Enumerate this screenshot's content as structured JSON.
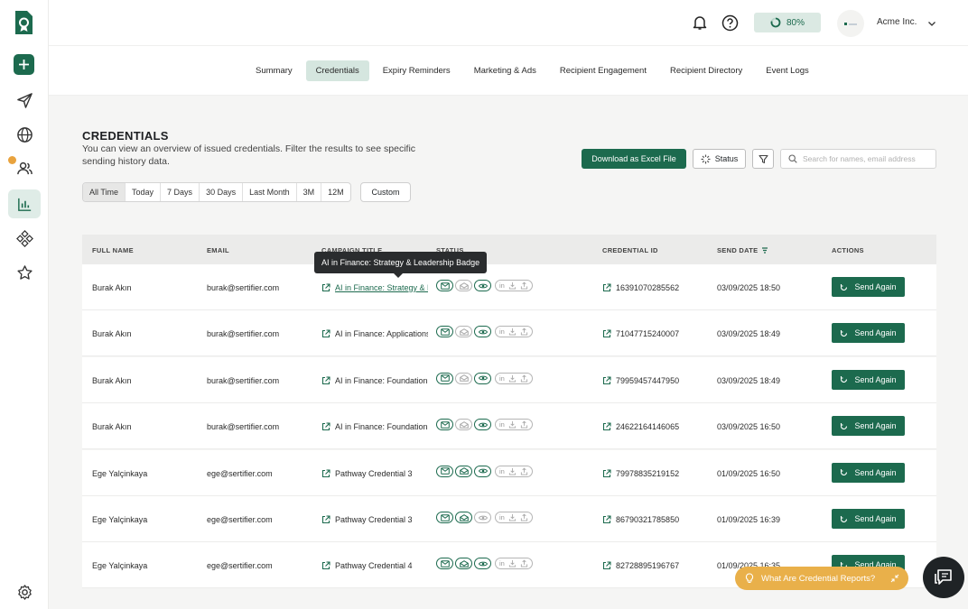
{
  "topbar": {
    "progress": "80%",
    "progress_value": 0.8,
    "org_name": "Acme Inc.",
    "icons": [
      "bell-icon",
      "help-icon",
      "chevron-down-icon"
    ]
  },
  "sidebar": {
    "items": [
      "logo-icon",
      "plus-icon",
      "send-icon",
      "globe-icon",
      "users-icon",
      "chart-icon",
      "components-icon",
      "star-icon",
      "gear-icon"
    ],
    "active": "chart-icon"
  },
  "tabs": [
    {
      "label": "Summary"
    },
    {
      "label": "Credentials"
    },
    {
      "label": "Expiry Reminders"
    },
    {
      "label": "Marketing & Ads"
    },
    {
      "label": "Recipient Engagement"
    },
    {
      "label": "Recipient Directory"
    },
    {
      "label": "Event Logs"
    }
  ],
  "page": {
    "title": "CREDENTIALS",
    "subtitle": "You can view an overview of issued credentials. Filter the results to see specific sending history data.",
    "download_label": "Download as Excel File",
    "status_label": "Status",
    "search_placeholder": "Search for names, email address"
  },
  "ranges": [
    "All Time",
    "Today",
    "7 Days",
    "30 Days",
    "Last Month",
    "3M",
    "12M"
  ],
  "custom_label": "Custom",
  "table": {
    "headers": {
      "name": "FULL NAME",
      "email": "EMAIL",
      "campaign": "CAMPAIGN TITLE",
      "status": "STATUS",
      "cred": "CREDENTIAL ID",
      "date": "SEND DATE",
      "actions": "ACTIONS"
    },
    "send_again_label": "Send Again",
    "rows": [
      {
        "name": "Burak Akın",
        "email": "burak@sertifier.com",
        "campaign": "AI in Finance: Strategy & L",
        "cred_id": "16391070285562",
        "date": "03/09/2025 18:50",
        "status_on": [
          true,
          false,
          true
        ]
      },
      {
        "name": "Burak Akın",
        "email": "burak@sertifier.com",
        "campaign": "AI in Finance: Applications",
        "cred_id": "71047715240007",
        "date": "03/09/2025 18:49",
        "status_on": [
          true,
          false,
          true
        ]
      },
      {
        "name": "Burak Akın",
        "email": "burak@sertifier.com",
        "campaign": "AI in Finance: Foundations",
        "cred_id": "79959457447950",
        "date": "03/09/2025 18:49",
        "status_on": [
          true,
          false,
          true
        ]
      },
      {
        "name": "Burak Akın",
        "email": "burak@sertifier.com",
        "campaign": "AI in Finance: Foundations",
        "cred_id": "24622164146065",
        "date": "03/09/2025 16:50",
        "status_on": [
          true,
          false,
          true
        ]
      },
      {
        "name": "Ege Yalçinkaya",
        "email": "ege@sertifier.com",
        "campaign": "Pathway Credential 3",
        "cred_id": "79978835219152",
        "date": "01/09/2025 16:50",
        "status_on": [
          true,
          true,
          true
        ]
      },
      {
        "name": "Ege Yalçinkaya",
        "email": "ege@sertifier.com",
        "campaign": "Pathway Credential 3",
        "cred_id": "86790321785850",
        "date": "01/09/2025 16:39",
        "status_on": [
          true,
          true,
          false
        ]
      },
      {
        "name": "Ege Yalçinkaya",
        "email": "ege@sertifier.com",
        "campaign": "Pathway Credential 4",
        "cred_id": "82728895196767",
        "date": "01/09/2025 16:35",
        "status_on": [
          true,
          true,
          true
        ]
      }
    ]
  },
  "tooltip": "AI in Finance: Strategy & Leadership Badge",
  "reports_label": "What Are Credential Reports?",
  "colors": {
    "accent": "#1c6a4e",
    "accent_light": "#d5e6df",
    "warning": "#e9b04a"
  }
}
